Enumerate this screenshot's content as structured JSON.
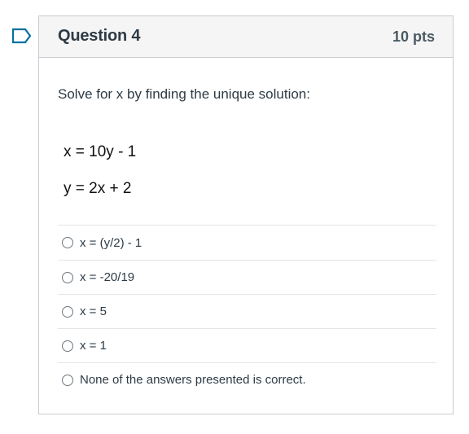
{
  "question": {
    "title": "Question 4",
    "points": "10 pts",
    "prompt": "Solve for x by finding the unique solution:",
    "equations": [
      "x = 10y - 1",
      "y = 2x + 2"
    ]
  },
  "answers": [
    {
      "label": "x = (y/2) - 1"
    },
    {
      "label": "x = -20/19"
    },
    {
      "label": "x = 5"
    },
    {
      "label": "x = 1"
    },
    {
      "label": "None of the answers presented is correct."
    }
  ],
  "colors": {
    "flag": "#0770a3",
    "header_bg": "#f5f5f5",
    "border": "#c7cdd1"
  },
  "icons": {
    "flag": "flag-outline-icon",
    "radio": "radio-empty-icon"
  }
}
